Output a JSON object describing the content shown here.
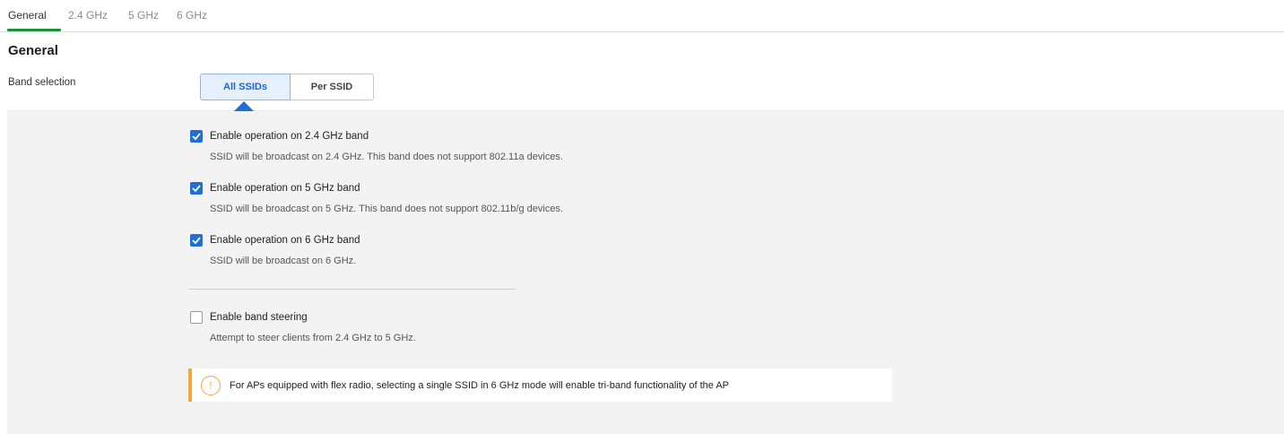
{
  "tabs": [
    {
      "label": "General",
      "active": true
    },
    {
      "label": "2.4 GHz",
      "active": false
    },
    {
      "label": "5 GHz",
      "active": false
    },
    {
      "label": "6 GHz",
      "active": false
    }
  ],
  "section_title": "General",
  "band_selection": {
    "label": "Band selection",
    "options": [
      "All SSIDs",
      "Per SSID"
    ],
    "selected": "All SSIDs"
  },
  "bands": [
    {
      "label": "Enable operation on 2.4 GHz band",
      "description": "SSID will be broadcast on 2.4 GHz. This band does not support 802.11a devices.",
      "checked": true
    },
    {
      "label": "Enable operation on 5 GHz band",
      "description": "SSID will be broadcast on 5 GHz. This band does not support 802.11b/g devices.",
      "checked": true
    },
    {
      "label": "Enable operation on 6 GHz band",
      "description": "SSID will be broadcast on 6 GHz.",
      "checked": true
    }
  ],
  "band_steering": {
    "label": "Enable band steering",
    "description": "Attempt to steer clients from 2.4 GHz to 5 GHz.",
    "checked": false
  },
  "info_banner": {
    "icon": "warning-icon",
    "icon_glyph": "!",
    "text": "For APs equipped with flex radio, selecting a single SSID in 6 GHz mode will enable tri-band functionality of the AP"
  },
  "colors": {
    "accent": "#1f6fd6",
    "tab_underline": "#1f8f3a",
    "warning": "#f0a83a",
    "panel_bg": "#f3f3f3"
  }
}
